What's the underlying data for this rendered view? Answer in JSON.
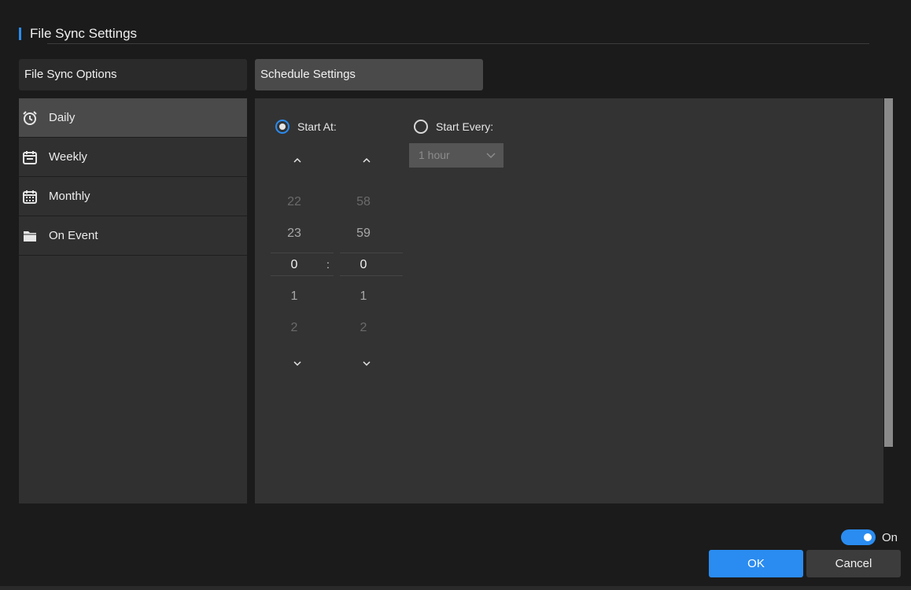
{
  "dialog": {
    "title": "File Sync Settings"
  },
  "tabs": [
    {
      "label": "File Sync Options",
      "active": false
    },
    {
      "label": "Schedule Settings",
      "active": true
    }
  ],
  "sidebar": {
    "items": [
      {
        "label": "Daily",
        "icon": "alarm-clock-icon",
        "active": true
      },
      {
        "label": "Weekly",
        "icon": "calendar-week-icon",
        "active": false
      },
      {
        "label": "Monthly",
        "icon": "calendar-month-icon",
        "active": false
      },
      {
        "label": "On Event",
        "icon": "folder-icon",
        "active": false
      }
    ]
  },
  "schedule": {
    "start_at": {
      "label": "Start At:",
      "checked": true
    },
    "start_every": {
      "label": "Start Every:",
      "checked": false,
      "interval_value": "1 hour"
    },
    "time_picker": {
      "separator": ":",
      "hours": {
        "prev2": "22",
        "prev1": "23",
        "selected": "0",
        "next1": "1",
        "next2": "2"
      },
      "minutes": {
        "prev2": "58",
        "prev1": "59",
        "selected": "0",
        "next1": "1",
        "next2": "2"
      },
      "up_arrow": "^",
      "down_arrow": "⌄"
    }
  },
  "footer": {
    "toggle": {
      "label": "On",
      "on": true
    },
    "ok_label": "OK",
    "cancel_label": "Cancel"
  },
  "colors": {
    "accent": "#2a8cf0",
    "background": "#1b1b1b",
    "panel": "#333333"
  }
}
